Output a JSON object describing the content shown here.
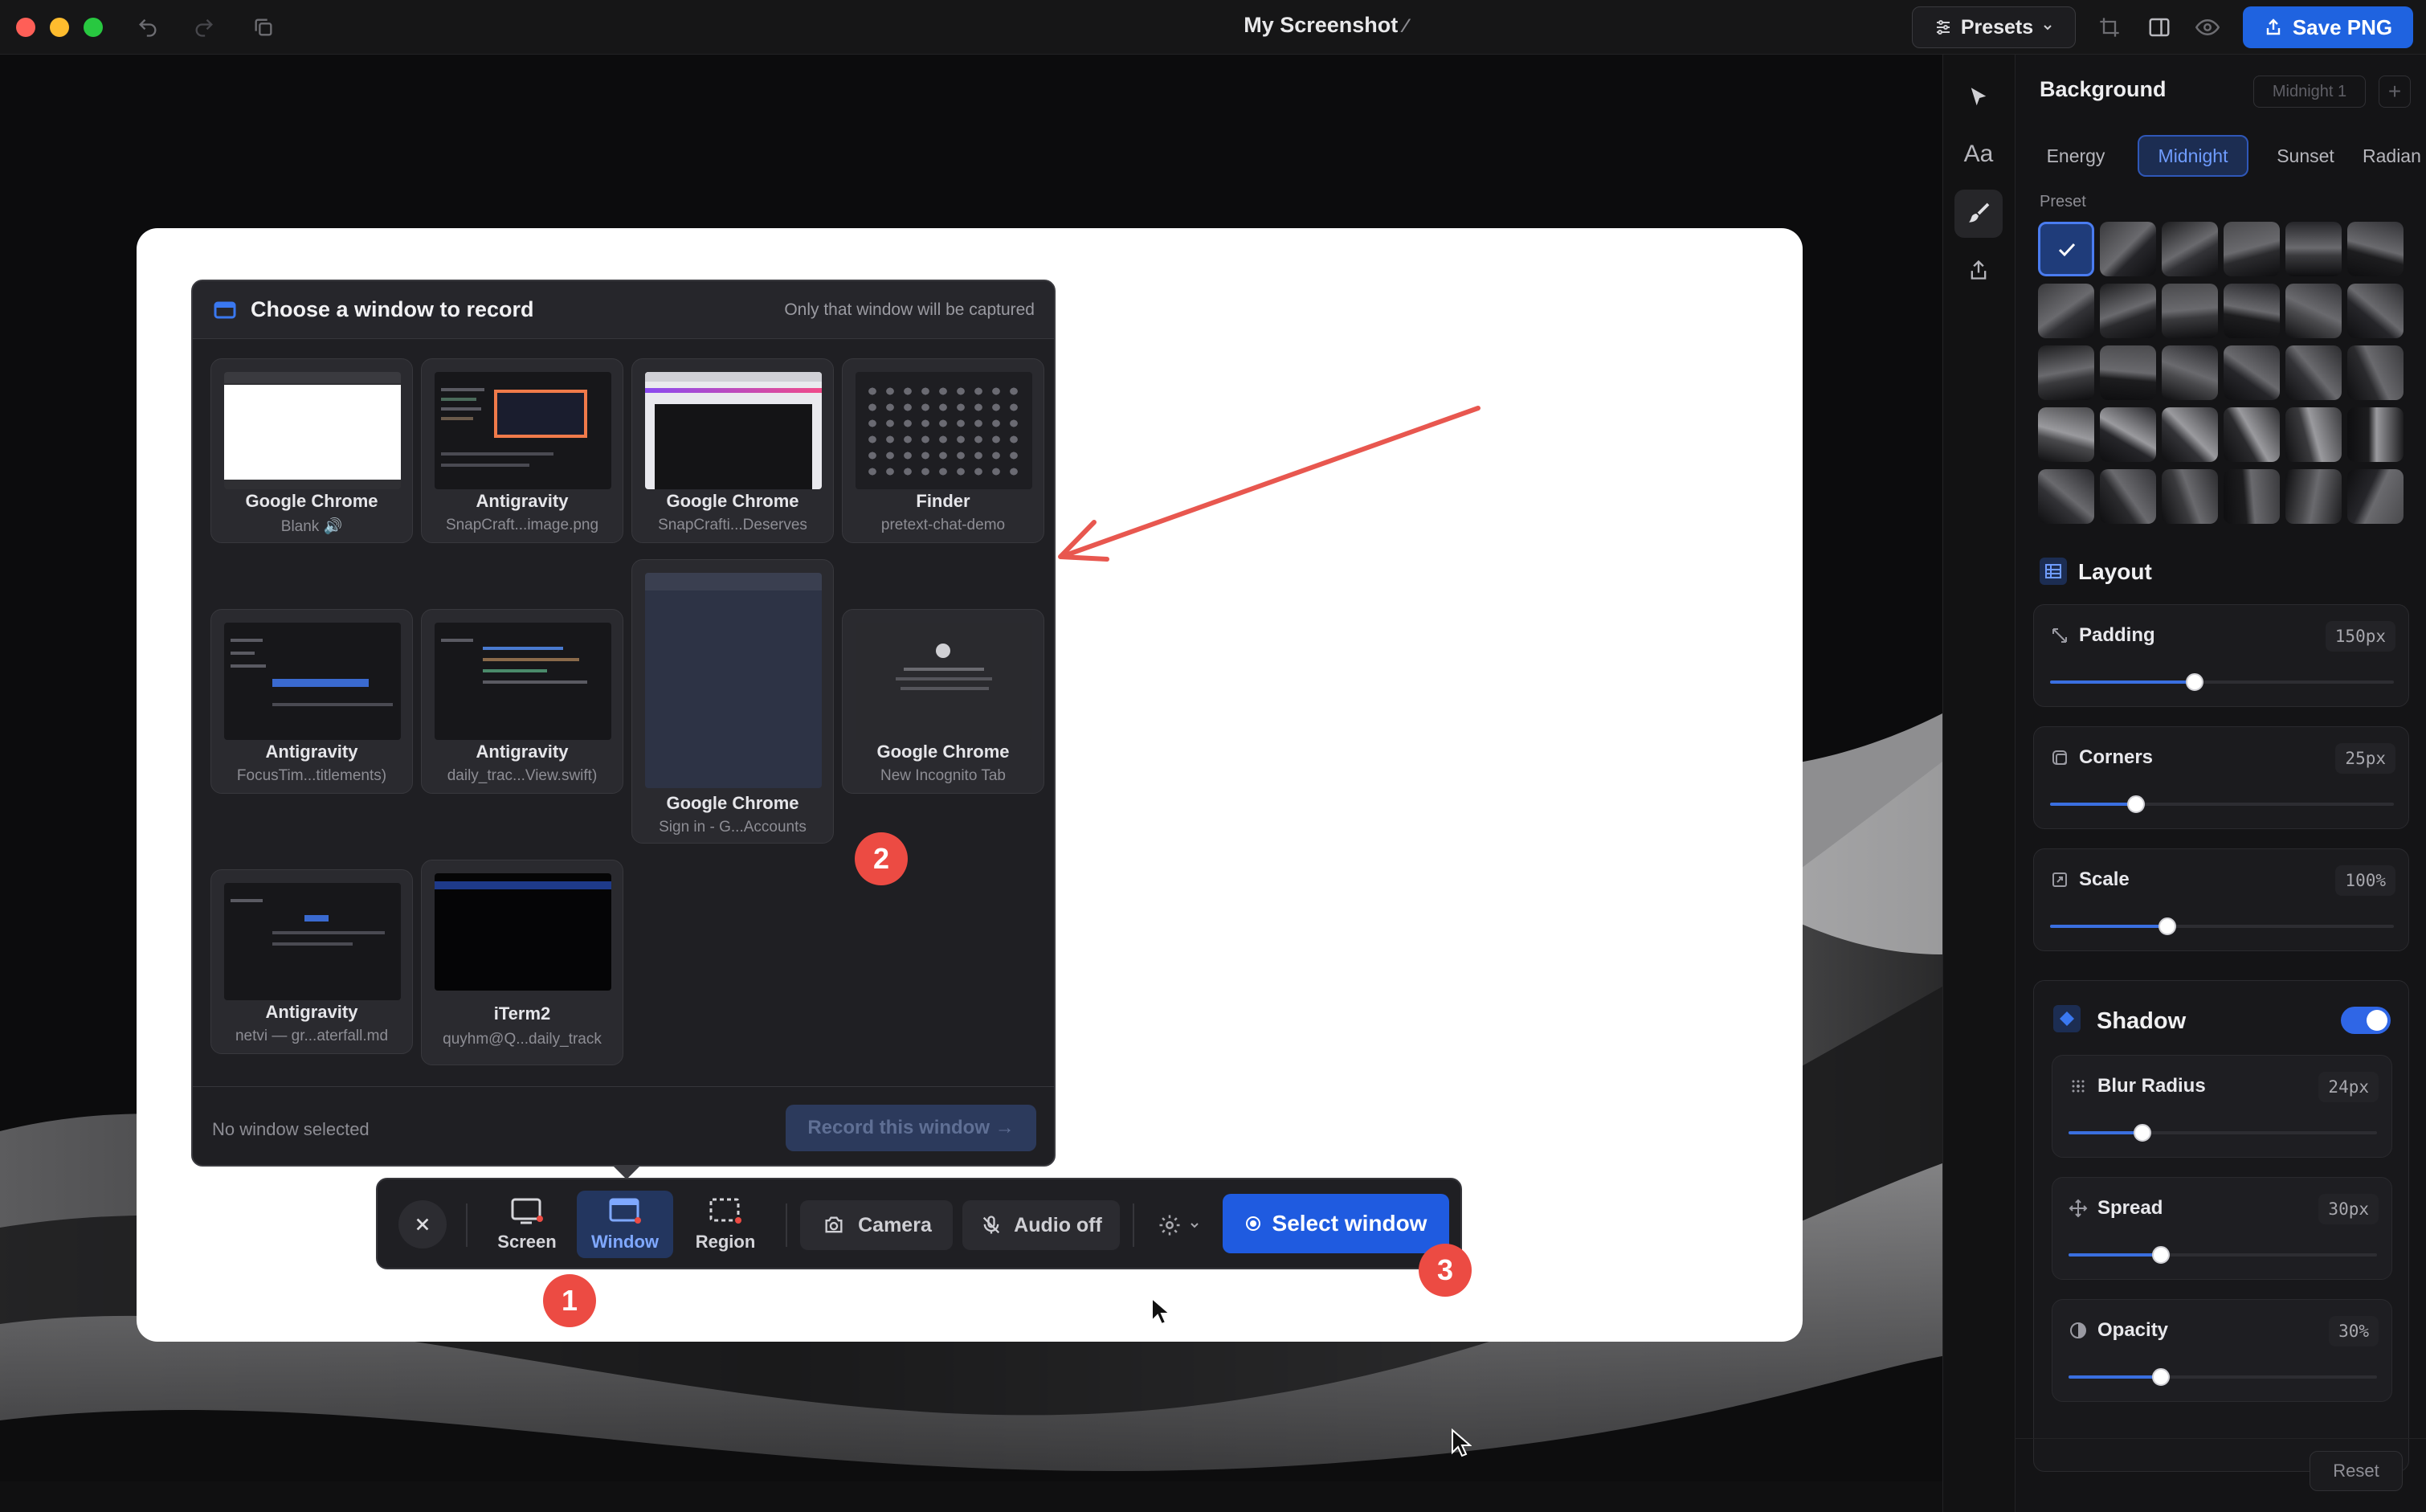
{
  "window": {
    "title": "My Screenshot",
    "presets_label": "Presets",
    "save_label": "Save PNG"
  },
  "picker": {
    "title": "Choose a window to record",
    "subtitle": "Only that window will be captured",
    "windows": [
      {
        "app": "Google Chrome",
        "detail": "Blank 🔊"
      },
      {
        "app": "Antigravity",
        "detail": "SnapCraft...image.png"
      },
      {
        "app": "Google Chrome",
        "detail": "SnapCrafti...Deserves"
      },
      {
        "app": "Finder",
        "detail": "pretext-chat-demo"
      },
      {
        "app": "Antigravity",
        "detail": "FocusTim...titlements)"
      },
      {
        "app": "Antigravity",
        "detail": "daily_trac...View.swift)"
      },
      {
        "app": "Google Chrome",
        "detail": "Sign in - G...Accounts"
      },
      {
        "app": "Google Chrome",
        "detail": "New Incognito Tab"
      },
      {
        "app": "Antigravity",
        "detail": "netvi — gr...aterfall.md"
      },
      {
        "app": "iTerm2",
        "detail": "quyhm@Q...daily_track"
      }
    ],
    "status": "No window selected",
    "record_label": "Record this window →"
  },
  "toolbar": {
    "modes": [
      "Screen",
      "Window",
      "Region"
    ],
    "active_mode": "Window",
    "camera_label": "Camera",
    "audio_label": "Audio off",
    "select_label": "Select window"
  },
  "badges": [
    "1",
    "2",
    "3"
  ],
  "panel": {
    "background_title": "Background",
    "current_preset": "Midnight 1",
    "add_label": "+",
    "categories": [
      "Energy",
      "Midnight",
      "Sunset",
      "Radian"
    ],
    "active_category": "Midnight",
    "preset_label": "Preset",
    "layout_title": "Layout",
    "layout_controls": [
      {
        "label": "Padding",
        "value": "150px",
        "level": 0.42
      },
      {
        "label": "Corners",
        "value": "25px",
        "level": 0.25
      },
      {
        "label": "Scale",
        "value": "100%",
        "level": 0.34
      }
    ],
    "shadow_title": "Shadow",
    "shadow_enabled": true,
    "shadow_controls": [
      {
        "label": "Blur Radius",
        "value": "24px",
        "level": 0.24
      },
      {
        "label": "Spread",
        "value": "30px",
        "level": 0.3
      },
      {
        "label": "Opacity",
        "value": "30%",
        "level": 0.3
      }
    ],
    "reset_label": "Reset"
  },
  "colors": {
    "accent": "#1f63e0",
    "badge": "#ec4b43",
    "arrow": "#e8574f"
  }
}
